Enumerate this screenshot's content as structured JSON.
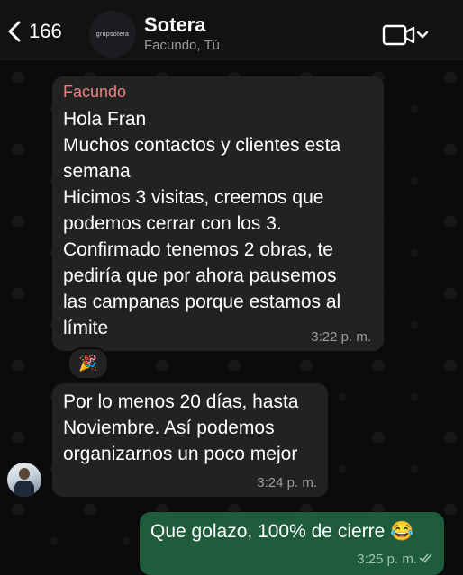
{
  "header": {
    "back_count": "166",
    "avatar_text": "grupsotera",
    "title": "Sotera",
    "subtitle": "Facundo, Tú",
    "video_icon": "video-call-icon",
    "chevron_icon": "chevron-down-icon"
  },
  "messages": [
    {
      "sender": "Facundo",
      "sender_color": "#e7837f",
      "lines": [
        "Hola Fran",
        "Muchos contactos y clientes esta",
        "semana",
        "Hicimos 3 visitas, creemos que",
        "podemos cerrar con los 3.",
        "Confirmado tenemos 2 obras, te",
        "pediría que por ahora pausemos",
        "las campanas porque estamos al",
        "límite"
      ],
      "time": "3:22 p. m.",
      "reaction": "🎉"
    },
    {
      "lines": [
        "Por lo menos 20 días, hasta",
        "Noviembre. Así podemos",
        "organizarnos un poco mejor"
      ],
      "time": "3:24 p. m."
    },
    {
      "outgoing": true,
      "text": "Que golazo, 100% de cierre 😂",
      "time": "3:25 p. m.",
      "bubble_color": "#1e5c3c",
      "status_icon": "double-check-icon"
    }
  ]
}
